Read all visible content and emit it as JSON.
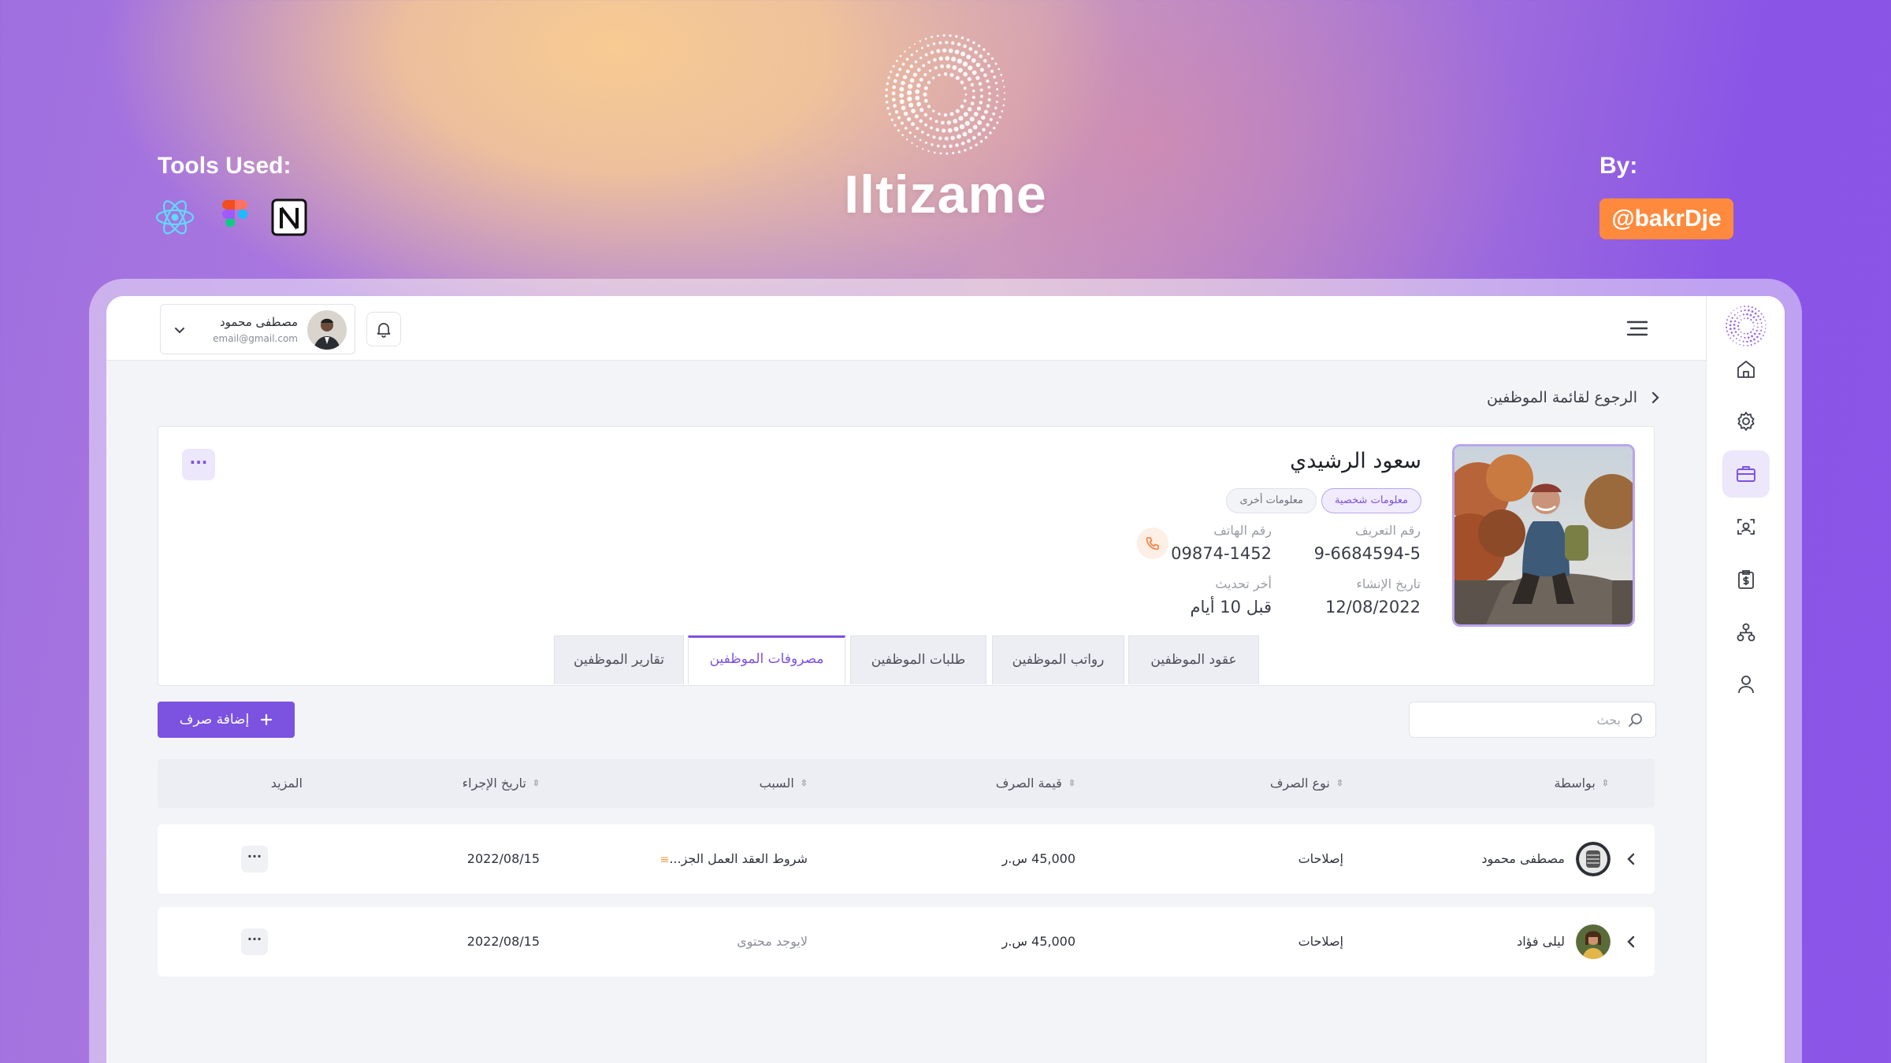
{
  "hero": {
    "brand_title": "Iltizame",
    "tools_label": "Tools Used:",
    "tools": [
      "react-icon",
      "figma-icon",
      "notion-icon"
    ],
    "by_label": "By:",
    "handle": "@bakrDje"
  },
  "colors": {
    "accent": "#7c52e0",
    "accent_light": "#ece7fb",
    "handle_badge": "#ff8a3d",
    "app_background": "#f3f4f8"
  },
  "topbar": {
    "user_name": "مصطفى محمود",
    "user_email": "email@gmail.com"
  },
  "sidebar": {
    "items": [
      "home-icon",
      "gear-icon",
      "briefcase-icon",
      "face-scan-icon",
      "clipboard-dollar-icon",
      "org-chart-icon",
      "user-icon"
    ],
    "active_index": 2
  },
  "breadcrumb": {
    "back_label": "الرجوع لقائمة الموظفين"
  },
  "profile": {
    "name": "سعود الرشيدي",
    "pill_active": "معلومات شخصية",
    "pill_other": "معلومات أخرى",
    "id_label": "رقم التعريف",
    "id_value": "9-6684594-5",
    "phone_label": "رقم الهاتف",
    "phone_value": "09874-1452",
    "created_label": "تاريخ الإنشاء",
    "created_value": "12/08/2022",
    "updated_label": "أخر تحديث",
    "updated_value": "قبل 10 أيام",
    "more": "···"
  },
  "tabs": [
    {
      "label": "عقود الموظفين"
    },
    {
      "label": "رواتب الموظفين"
    },
    {
      "label": "طلبات الموظفين"
    },
    {
      "label": "مصروفات الموظفين"
    },
    {
      "label": "تقارير الموظفين"
    }
  ],
  "active_tab": 3,
  "search": {
    "placeholder": "بحث"
  },
  "add_button": {
    "label": "إضافة صرف"
  },
  "table": {
    "columns": [
      "بواسطة",
      "نوع الصرف",
      "قيمة الصرف",
      "السبب",
      "تاريخ الإجراء",
      "المزيد"
    ],
    "rows": [
      {
        "by": "مصطفى محمود",
        "type": "إصلاحات",
        "amount": "45,000 س.ر",
        "reason": "شروط العقد العمل الجز...",
        "date": "2022/08/15",
        "more": "···"
      },
      {
        "by": "ليلى فؤاد",
        "type": "إصلاحات",
        "amount": "45,000 س.ر",
        "reason": "لايوجد محتوى",
        "date": "2022/08/15",
        "more": "···"
      }
    ]
  }
}
